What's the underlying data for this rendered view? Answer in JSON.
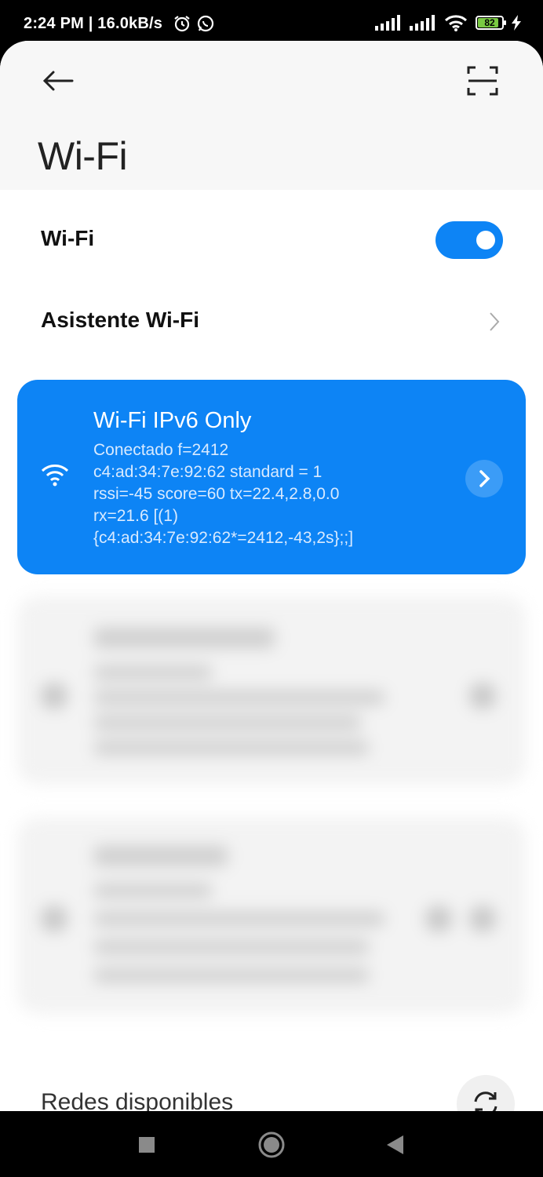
{
  "status_bar": {
    "time": "2:24 PM | 16.0kB/s",
    "battery_level": "82",
    "icons": [
      "alarm-icon",
      "whatsapp-icon",
      "signal-icon",
      "signal-icon",
      "wifi-icon",
      "battery-icon",
      "charging-icon"
    ]
  },
  "header": {
    "title": "Wi-Fi",
    "icons": [
      "back-arrow-icon",
      "scan-qr-icon"
    ]
  },
  "wifi_toggle": {
    "label": "Wi-Fi",
    "state": "on"
  },
  "assistant": {
    "label": "Asistente Wi-Fi"
  },
  "connected_network": {
    "name": "Wi-Fi IPv6 Only",
    "details": [
      "Conectado f=2412",
      "c4:ad:34:7e:92:62 standard = 1",
      "rssi=-45  score=60 tx=22.4,2.8,0.0",
      "rx=21.6 [(1)",
      "{c4:ad:34:7e:92:62*=2412,-43,2s};;]"
    ]
  },
  "available": {
    "title": "Redes disponibles"
  },
  "colors": {
    "accent": "#0d84f5",
    "background": "#ffffff",
    "header_bg": "#f7f7f7"
  },
  "navigation_bar": {
    "icons": [
      "recents-square-icon",
      "home-circle-icon",
      "back-triangle-icon"
    ]
  }
}
